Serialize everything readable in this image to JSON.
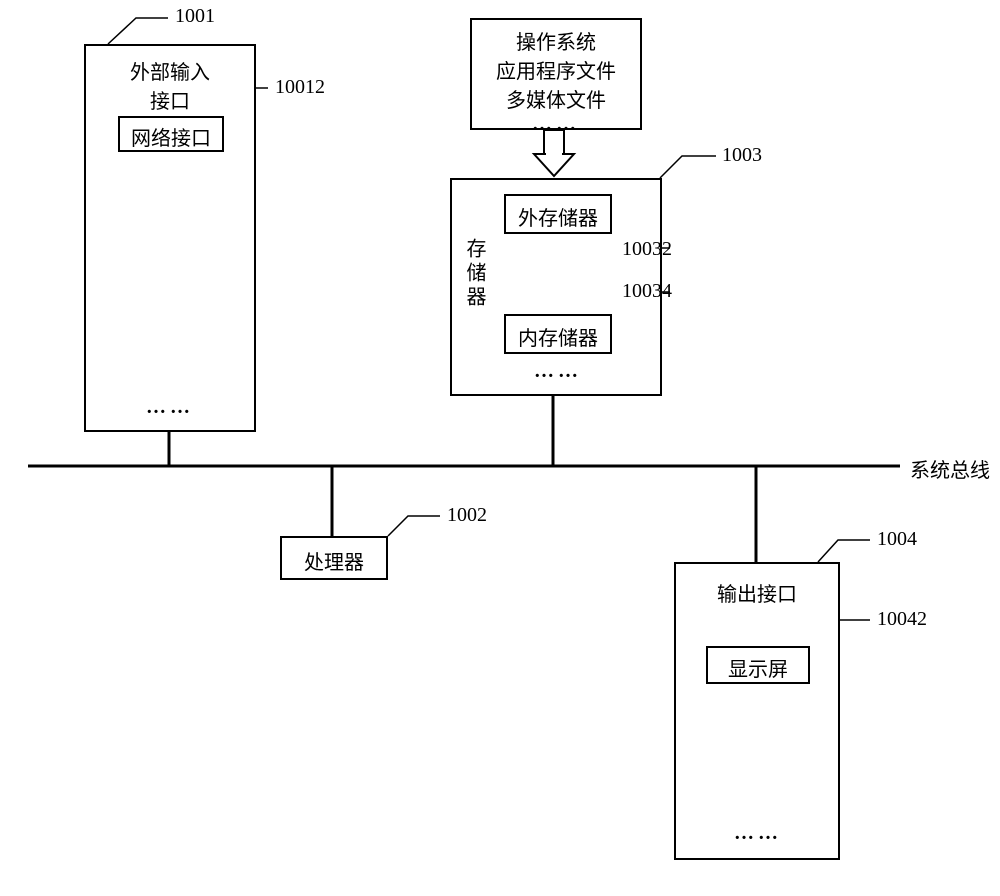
{
  "bus_label": "系统总线",
  "blocks": {
    "external_input": {
      "ref": "1001",
      "title_l1": "外部输入",
      "title_l2": "接口",
      "net_if": {
        "ref": "10012",
        "label": "网络接口"
      }
    },
    "files_box": {
      "l1": "操作系统",
      "l2": "应用程序文件",
      "l3": "多媒体文件"
    },
    "storage": {
      "ref": "1003",
      "side_label": "存储器",
      "ext": {
        "ref": "10032",
        "label": "外存储器"
      },
      "int": {
        "ref": "10034",
        "label": "内存储器"
      }
    },
    "processor": {
      "ref": "1002",
      "label": "处理器"
    },
    "output": {
      "ref": "1004",
      "title": "输出接口",
      "display": {
        "ref": "10042",
        "label": "显示屏"
      }
    }
  }
}
